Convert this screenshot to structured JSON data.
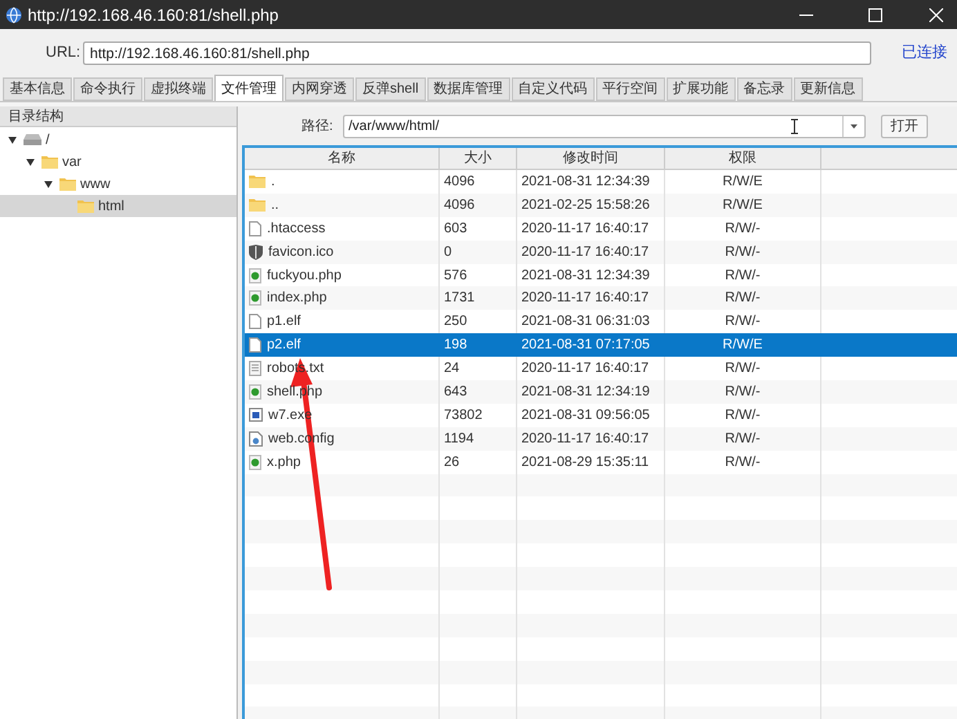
{
  "window": {
    "title": "http://192.168.46.160:81/shell.php"
  },
  "url_bar": {
    "label": "URL:",
    "value": "http://192.168.46.160:81/shell.php",
    "status": "已连接"
  },
  "tabs": [
    {
      "label": "基本信息",
      "selected": false
    },
    {
      "label": "命令执行",
      "selected": false
    },
    {
      "label": "虚拟终端",
      "selected": false
    },
    {
      "label": "文件管理",
      "selected": true
    },
    {
      "label": "内网穿透",
      "selected": false
    },
    {
      "label": "反弹shell",
      "selected": false
    },
    {
      "label": "数据库管理",
      "selected": false
    },
    {
      "label": "自定义代码",
      "selected": false
    },
    {
      "label": "平行空间",
      "selected": false
    },
    {
      "label": "扩展功能",
      "selected": false
    },
    {
      "label": "备忘录",
      "selected": false
    },
    {
      "label": "更新信息",
      "selected": false
    }
  ],
  "sidebar": {
    "title": "目录结构",
    "tree": [
      {
        "label": "/",
        "kind": "drive",
        "expanded": true,
        "selected": false,
        "children": [
          {
            "label": "var",
            "kind": "folder",
            "expanded": true,
            "selected": false,
            "children": [
              {
                "label": "www",
                "kind": "folder",
                "expanded": true,
                "selected": false,
                "children": [
                  {
                    "label": "html",
                    "kind": "folder",
                    "selected": true
                  }
                ]
              }
            ]
          }
        ]
      }
    ]
  },
  "path_bar": {
    "label": "路径:",
    "value": "/var/www/html/",
    "button": "打开"
  },
  "table": {
    "columns": [
      "名称",
      "大小",
      "修改时间",
      "权限"
    ],
    "rows": [
      {
        "kind": "folder",
        "cells": [
          ".",
          "4096",
          "2021-08-31 12:34:39",
          "R/W/E"
        ],
        "selected": false
      },
      {
        "kind": "folder",
        "cells": [
          "..",
          "4096",
          "2021-02-25 15:58:26",
          "R/W/E"
        ],
        "selected": false
      },
      {
        "kind": "file",
        "cells": [
          ".htaccess",
          "603",
          "2020-11-17 16:40:17",
          "R/W/-"
        ],
        "selected": false
      },
      {
        "kind": "shield",
        "cells": [
          "favicon.ico",
          "0",
          "2020-11-17 16:40:17",
          "R/W/-"
        ],
        "selected": false
      },
      {
        "kind": "script",
        "cells": [
          "fuckyou.php",
          "576",
          "2021-08-31 12:34:39",
          "R/W/-"
        ],
        "selected": false
      },
      {
        "kind": "script",
        "cells": [
          "index.php",
          "1731",
          "2020-11-17 16:40:17",
          "R/W/-"
        ],
        "selected": false
      },
      {
        "kind": "file",
        "cells": [
          "p1.elf",
          "250",
          "2021-08-31 06:31:03",
          "R/W/-"
        ],
        "selected": false
      },
      {
        "kind": "file",
        "cells": [
          "p2.elf",
          "198",
          "2021-08-31 07:17:05",
          "R/W/E"
        ],
        "selected": true
      },
      {
        "kind": "text",
        "cells": [
          "robots.txt",
          "24",
          "2020-11-17 16:40:17",
          "R/W/-"
        ],
        "selected": false
      },
      {
        "kind": "script",
        "cells": [
          "shell.php",
          "643",
          "2021-08-31 12:34:19",
          "R/W/-"
        ],
        "selected": false
      },
      {
        "kind": "program",
        "cells": [
          "w7.exe",
          "73802",
          "2021-08-31 09:56:05",
          "R/W/-"
        ],
        "selected": false
      },
      {
        "kind": "config",
        "cells": [
          "web.config",
          "1194",
          "2020-11-17 16:40:17",
          "R/W/-"
        ],
        "selected": false
      },
      {
        "kind": "script",
        "cells": [
          "x.php",
          "26",
          "2021-08-29 15:35:11",
          "R/W/-"
        ],
        "selected": false
      }
    ]
  }
}
